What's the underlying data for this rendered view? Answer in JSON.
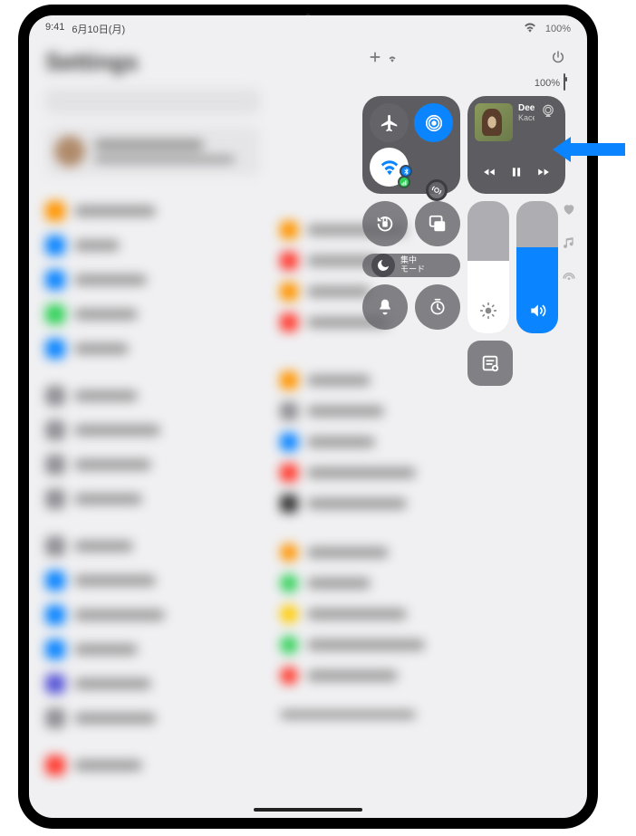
{
  "status_bar": {
    "time": "9:41",
    "date": "6月10日(月)"
  },
  "control_center": {
    "topbar": {
      "battery_percent": "100%"
    },
    "media": {
      "title": "Deeper Well",
      "artist": "Kacey Musgraves"
    },
    "focus": {
      "label": "集中\nモード"
    },
    "brightness": {
      "level_percent": 55
    },
    "volume": {
      "level_percent": 65
    }
  },
  "background": {
    "heading": "Settings"
  },
  "colors": {
    "accent_blue": "#0a84ff",
    "accent_green": "#30d158",
    "panel_dark": "rgba(60,60,65,0.82)"
  }
}
